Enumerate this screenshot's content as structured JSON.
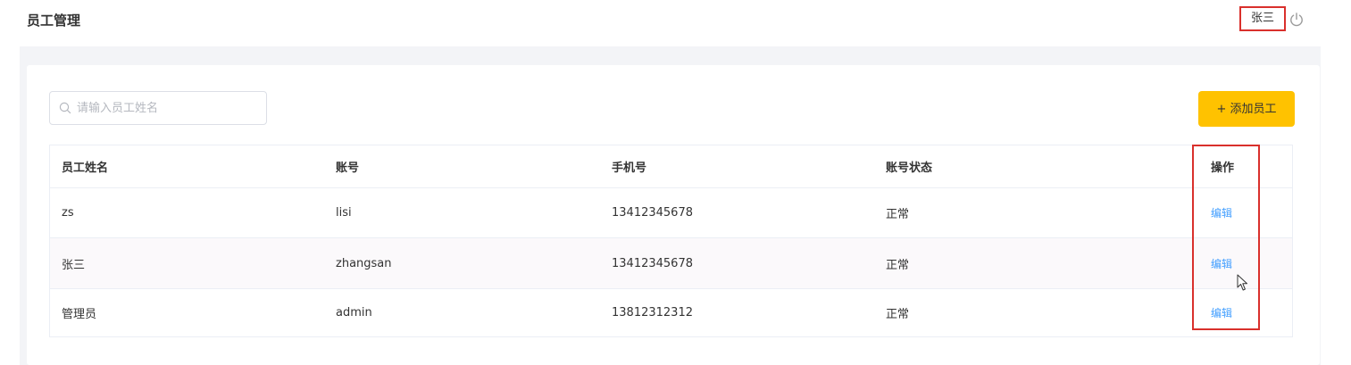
{
  "header": {
    "title": "员工管理",
    "user_name": "张三"
  },
  "toolbar": {
    "search_placeholder": "请输入员工姓名",
    "add_button_label": "+ 添加员工"
  },
  "table": {
    "columns": [
      "员工姓名",
      "账号",
      "手机号",
      "账号状态",
      "操作"
    ],
    "rows": [
      {
        "name": "zs",
        "account": "lisi",
        "phone": "13412345678",
        "status": "正常",
        "action": "编辑"
      },
      {
        "name": "张三",
        "account": "zhangsan",
        "phone": "13412345678",
        "status": "正常",
        "action": "编辑"
      },
      {
        "name": "管理员",
        "account": "admin",
        "phone": "13812312312",
        "status": "正常",
        "action": "编辑"
      }
    ]
  },
  "icons": {
    "search": "search-icon",
    "power": "power-icon"
  },
  "colors": {
    "accent": "#ffc200",
    "link": "#419eff",
    "highlight": "#d9302c",
    "background": "#f3f4f7"
  }
}
